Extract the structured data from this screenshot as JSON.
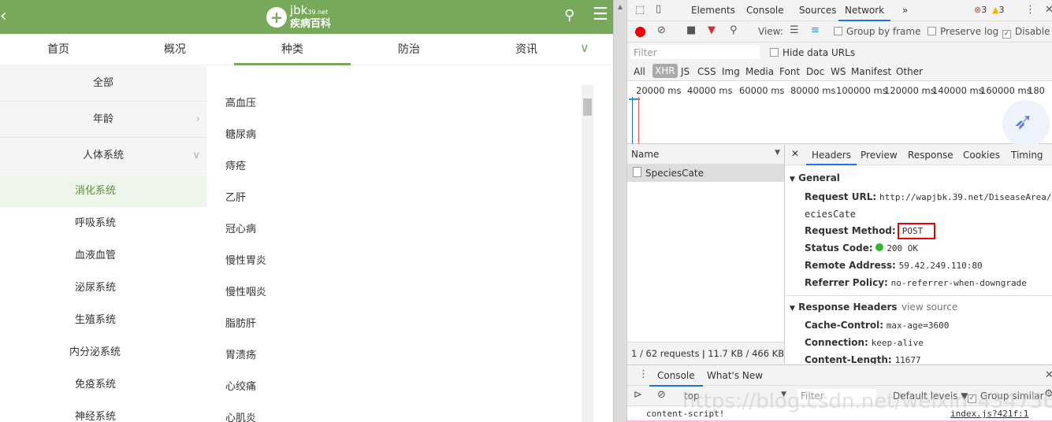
{
  "page": {
    "logo_text_top": "jbk",
    "logo_text_domain": "39.net",
    "logo_text_bottom": "疾病百科",
    "tabs": [
      "首页",
      "概况",
      "种类",
      "防治",
      "资讯"
    ],
    "sidebar": {
      "top": [
        "全部",
        "年龄",
        "人体系统"
      ],
      "sub": [
        "消化系统",
        "呼吸系统",
        "血液血管",
        "泌尿系统",
        "生殖系统",
        "内分泌系统",
        "免疫系统",
        "神经系统"
      ]
    },
    "diseases": [
      "高血压",
      "糖尿病",
      "痔疮",
      "乙肝",
      "冠心病",
      "慢性胃炎",
      "慢性咽炎",
      "脂肪肝",
      "胃溃疡",
      "心绞痛",
      "心肌炎"
    ],
    "accent": "#78a95a"
  },
  "devtools": {
    "tabs": [
      "Elements",
      "Console",
      "Sources",
      "Network"
    ],
    "errors": "3",
    "warnings": "3",
    "toolbar": {
      "view": "View:",
      "group_by_frame": "Group by frame",
      "preserve_log": "Preserve log",
      "disable_cache": "Disable c"
    },
    "filter_placeholder": "Filter",
    "hide_data_urls": "Hide data URLs",
    "types": [
      "All",
      "XHR",
      "JS",
      "CSS",
      "Img",
      "Media",
      "Font",
      "Doc",
      "WS",
      "Manifest",
      "Other"
    ],
    "timeline": [
      "20000 ms",
      "40000 ms",
      "60000 ms",
      "80000 ms",
      "100000 ms",
      "120000 ms",
      "140000 ms",
      "160000 ms",
      "180"
    ],
    "name_header": "Name",
    "request": "SpeciesCate",
    "detail_tabs": [
      "Headers",
      "Preview",
      "Response",
      "Cookies",
      "Timing"
    ],
    "general": {
      "title": "General",
      "url_k": "Request URL:",
      "url_v": "http://wapjbk.39.net/DiseaseArea/Sp",
      "url_v2": "eciesCate",
      "method_k": "Request Method:",
      "method_v": "POST",
      "status_k": "Status Code:",
      "status_v": "200 OK",
      "remote_k": "Remote Address:",
      "remote_v": "59.42.249.110:80",
      "ref_k": "Referrer Policy:",
      "ref_v": "no-referrer-when-downgrade"
    },
    "response": {
      "title": "Response Headers",
      "view_source": "view source",
      "cc_k": "Cache-Control:",
      "cc_v": "max-age=3600",
      "conn_k": "Connection:",
      "conn_v": "keep-alive",
      "cl_k": "Content-Length:",
      "cl_v": "11677"
    },
    "summary": "1 / 62 requests  ǀ  11.7 KB / 466 KB ...",
    "drawer_tabs": [
      "Console",
      "What's New"
    ],
    "console": {
      "context": "top",
      "filter_placeholder": "Filter",
      "levels": "Default levels ▼",
      "group_similar": "Group similar",
      "log": "content-script!",
      "source": "index.js?421f:1"
    },
    "watermark": "https://blog.csdn.net/weixin_43475664"
  }
}
